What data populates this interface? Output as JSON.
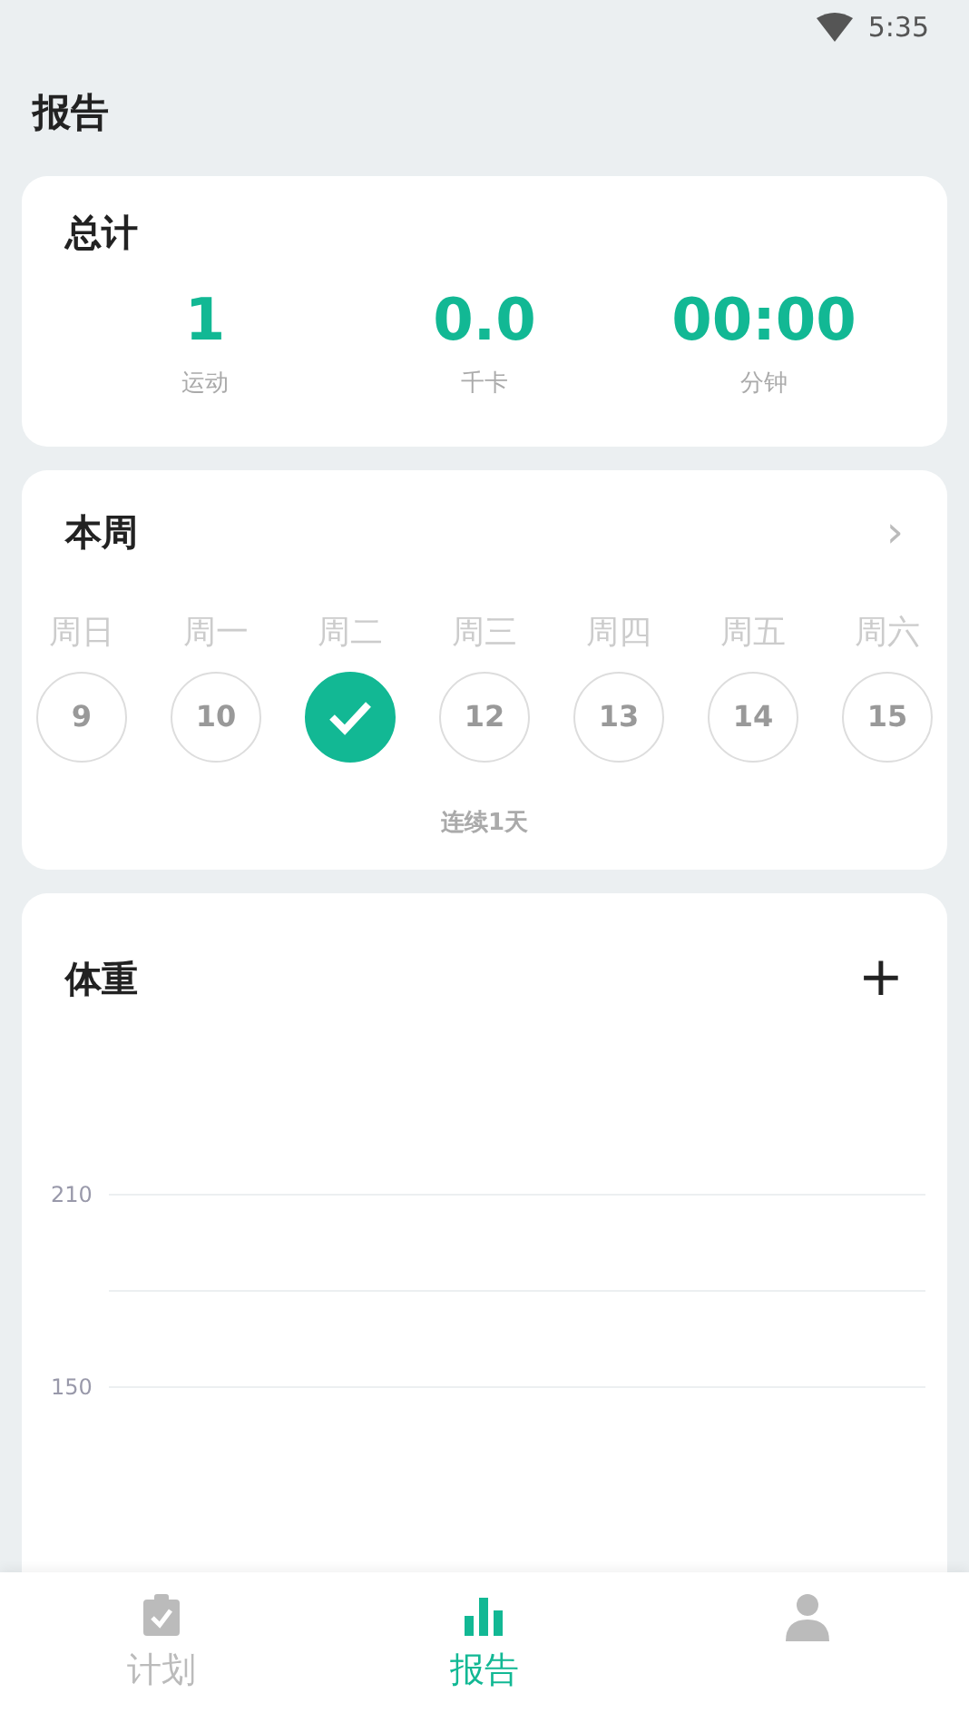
{
  "status_bar": {
    "time": "5:35"
  },
  "page_title": "报告",
  "totals": {
    "title": "总计",
    "stats": [
      {
        "value": "1",
        "label": "运动"
      },
      {
        "value": "0.0",
        "label": "千卡"
      },
      {
        "value": "00:00",
        "label": "分钟"
      }
    ]
  },
  "week": {
    "title": "本周",
    "chevron": "›",
    "days": [
      {
        "weekday": "周日",
        "date": "9",
        "done": false
      },
      {
        "weekday": "周一",
        "date": "10",
        "done": false
      },
      {
        "weekday": "周二",
        "done": true
      },
      {
        "weekday": "周三",
        "date": "12",
        "done": false
      },
      {
        "weekday": "周四",
        "date": "13",
        "done": false
      },
      {
        "weekday": "周五",
        "date": "14",
        "done": false
      },
      {
        "weekday": "周六",
        "date": "15",
        "done": false
      }
    ],
    "streak": "连续1天"
  },
  "weight": {
    "title": "体重",
    "add": "+",
    "axis_labels": [
      "210",
      "150"
    ]
  },
  "nav": [
    {
      "label": "计划",
      "selected": false
    },
    {
      "label": "报告",
      "selected": true
    },
    {
      "selected": false
    }
  ]
}
